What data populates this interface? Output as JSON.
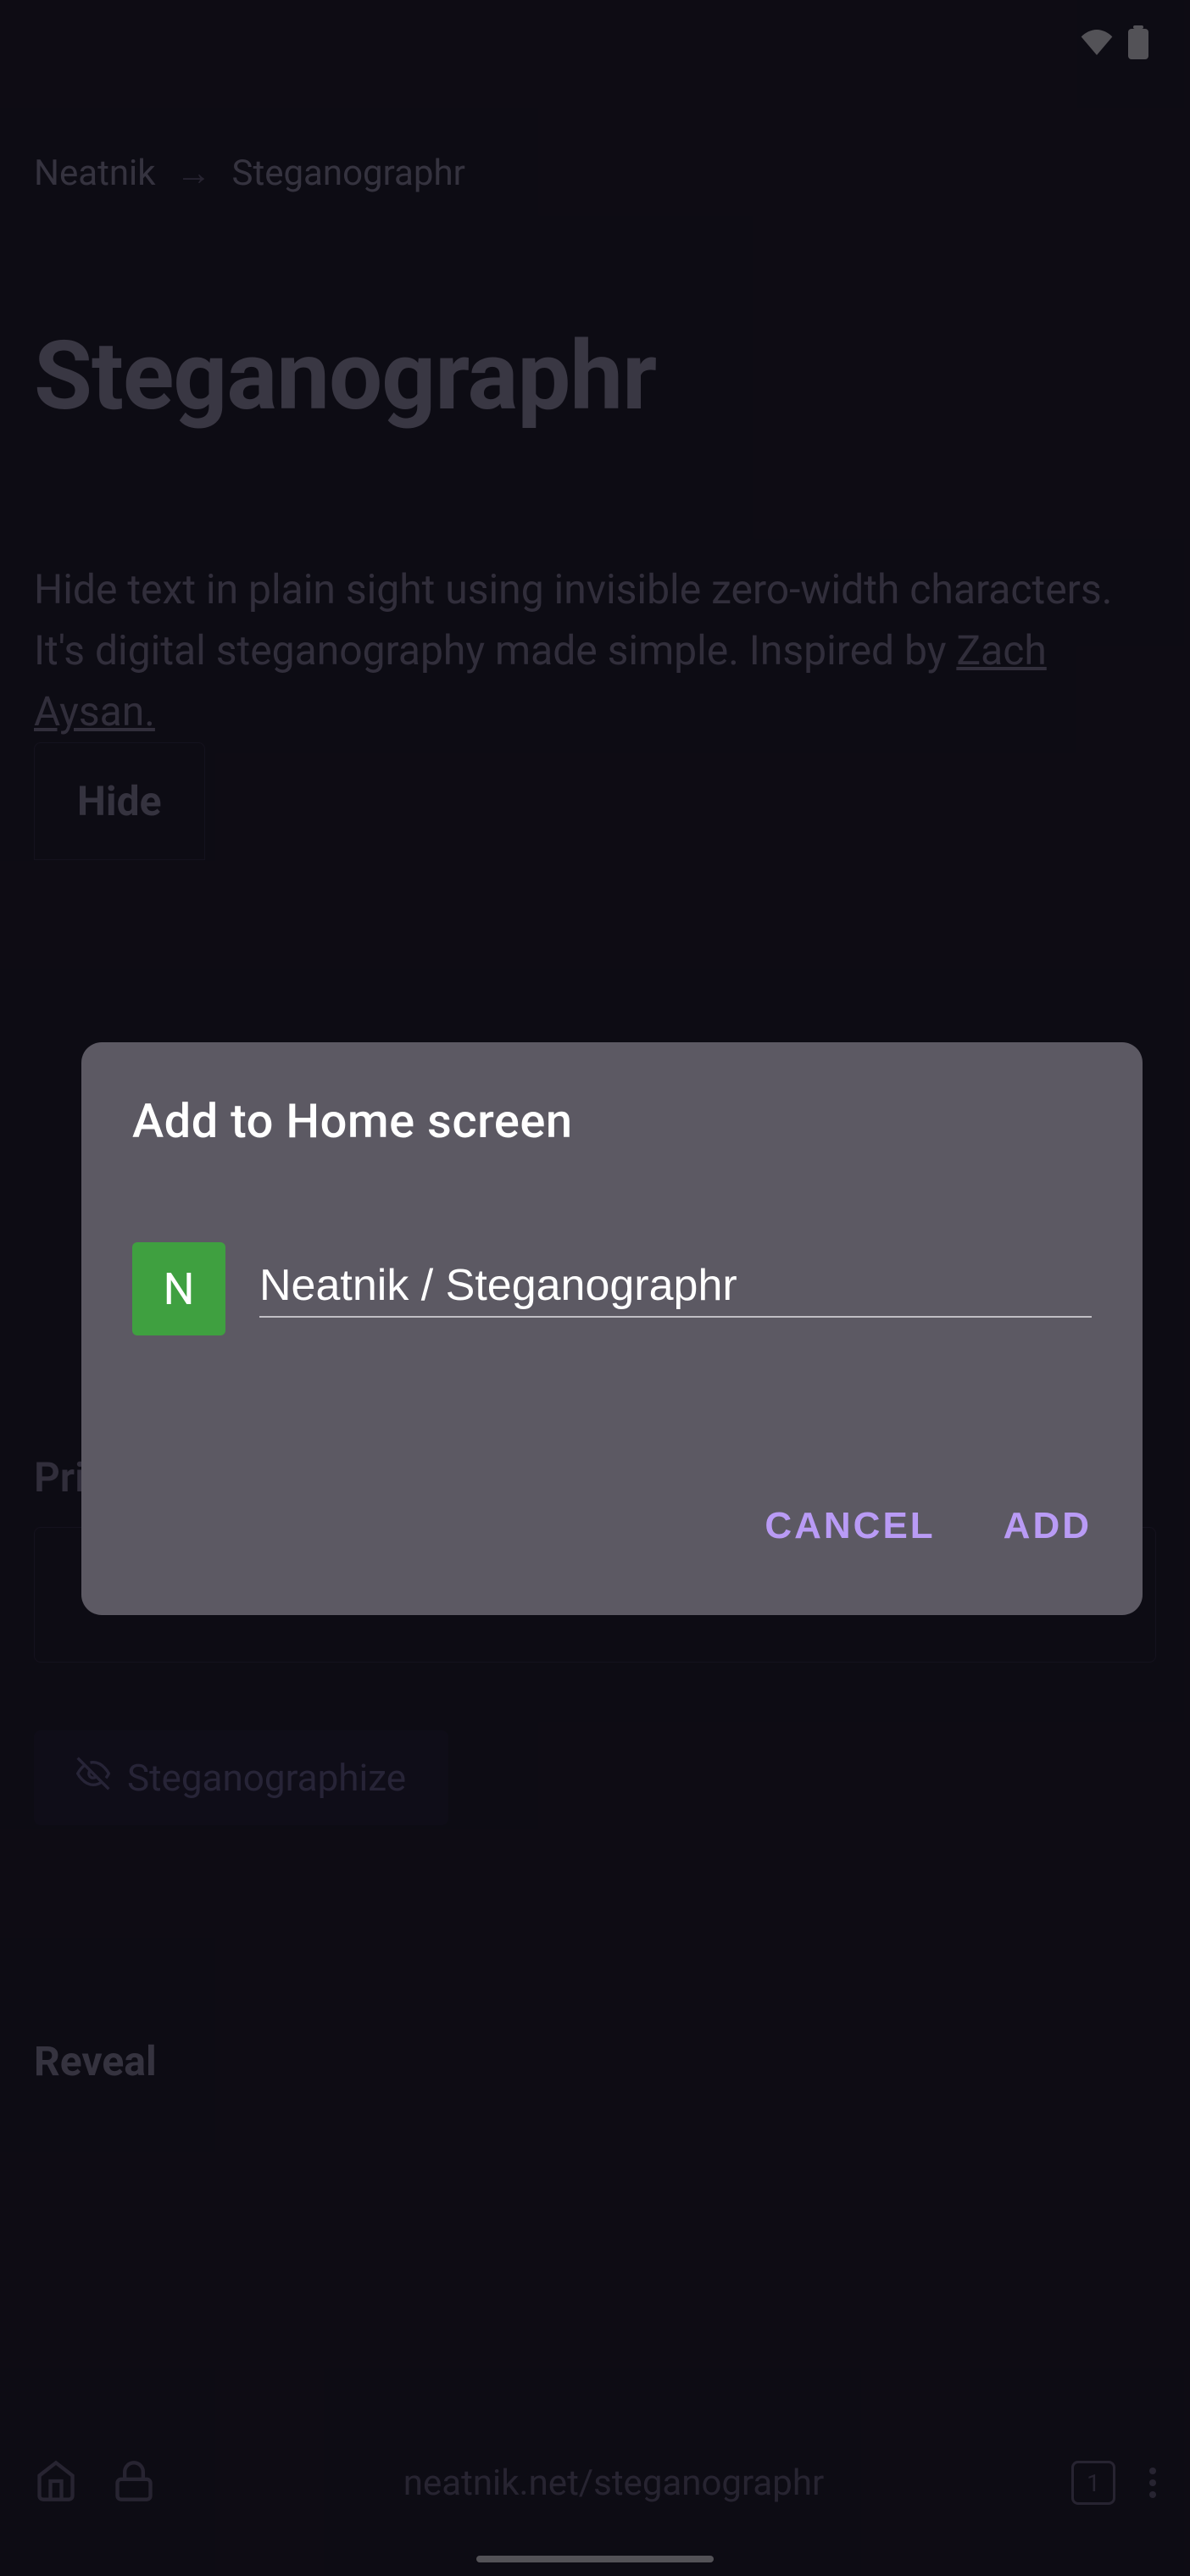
{
  "statusbar": {
    "wifi": "wifi",
    "battery": "battery-full"
  },
  "background": {
    "breadcrumb": {
      "parent": "Neatnik",
      "arrow": "→",
      "current": "Steganographr"
    },
    "title": "Steganographr",
    "description_pre": "Hide text in plain sight using invisible zero-width characters. It's digital steganography made simple. Inspired by ",
    "description_link": "Zach Aysan.",
    "sections": {
      "hide": {
        "tab": "Hide",
        "private_label": "Private message",
        "button": "Steganographize"
      },
      "reveal": {
        "tab": "Reveal"
      }
    }
  },
  "browser": {
    "url": "neatnik.net/steganographr",
    "tab_count": "1"
  },
  "dialog": {
    "title": "Add to Home screen",
    "favicon_letter": "N",
    "name_value": "Neatnik / Steganographr",
    "cancel": "CANCEL",
    "add": "ADD"
  }
}
